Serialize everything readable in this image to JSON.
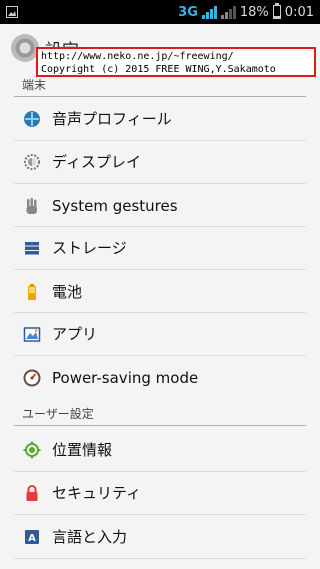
{
  "status_bar": {
    "network_type": "3G",
    "battery_percent": "18%",
    "time": "0:01",
    "battery_level": 0.18,
    "icons": [
      "image-icon",
      "signal-icon",
      "signal-icon",
      "battery-icon"
    ]
  },
  "action_bar": {
    "title": "設定",
    "icon": "settings-icon"
  },
  "overlay": {
    "line1": "http://www.neko.ne.jp/~freewing/",
    "line2": "Copyright (c) 2015 FREE WING,Y.Sakamoto"
  },
  "sections": [
    {
      "header": "端末",
      "items": [
        {
          "label": "音声プロフィール",
          "icon": "sound-profile-icon"
        },
        {
          "label": "ディスプレイ",
          "icon": "display-icon"
        },
        {
          "label": "System gestures",
          "icon": "hand-gesture-icon"
        },
        {
          "label": "ストレージ",
          "icon": "storage-icon"
        },
        {
          "label": "電池",
          "icon": "battery-icon"
        },
        {
          "label": "アプリ",
          "icon": "apps-icon"
        },
        {
          "label": "Power-saving mode",
          "icon": "power-saving-icon"
        }
      ]
    },
    {
      "header": "ユーザー設定",
      "items": [
        {
          "label": "位置情報",
          "icon": "location-icon"
        },
        {
          "label": "セキュリティ",
          "icon": "lock-icon"
        },
        {
          "label": "言語と入力",
          "icon": "language-icon"
        }
      ]
    }
  ],
  "colors": {
    "accent": "#33b5e5",
    "status_bar_bg": "#000000",
    "background": "#f4f4f4",
    "overlay_border": "#e01a1a"
  }
}
